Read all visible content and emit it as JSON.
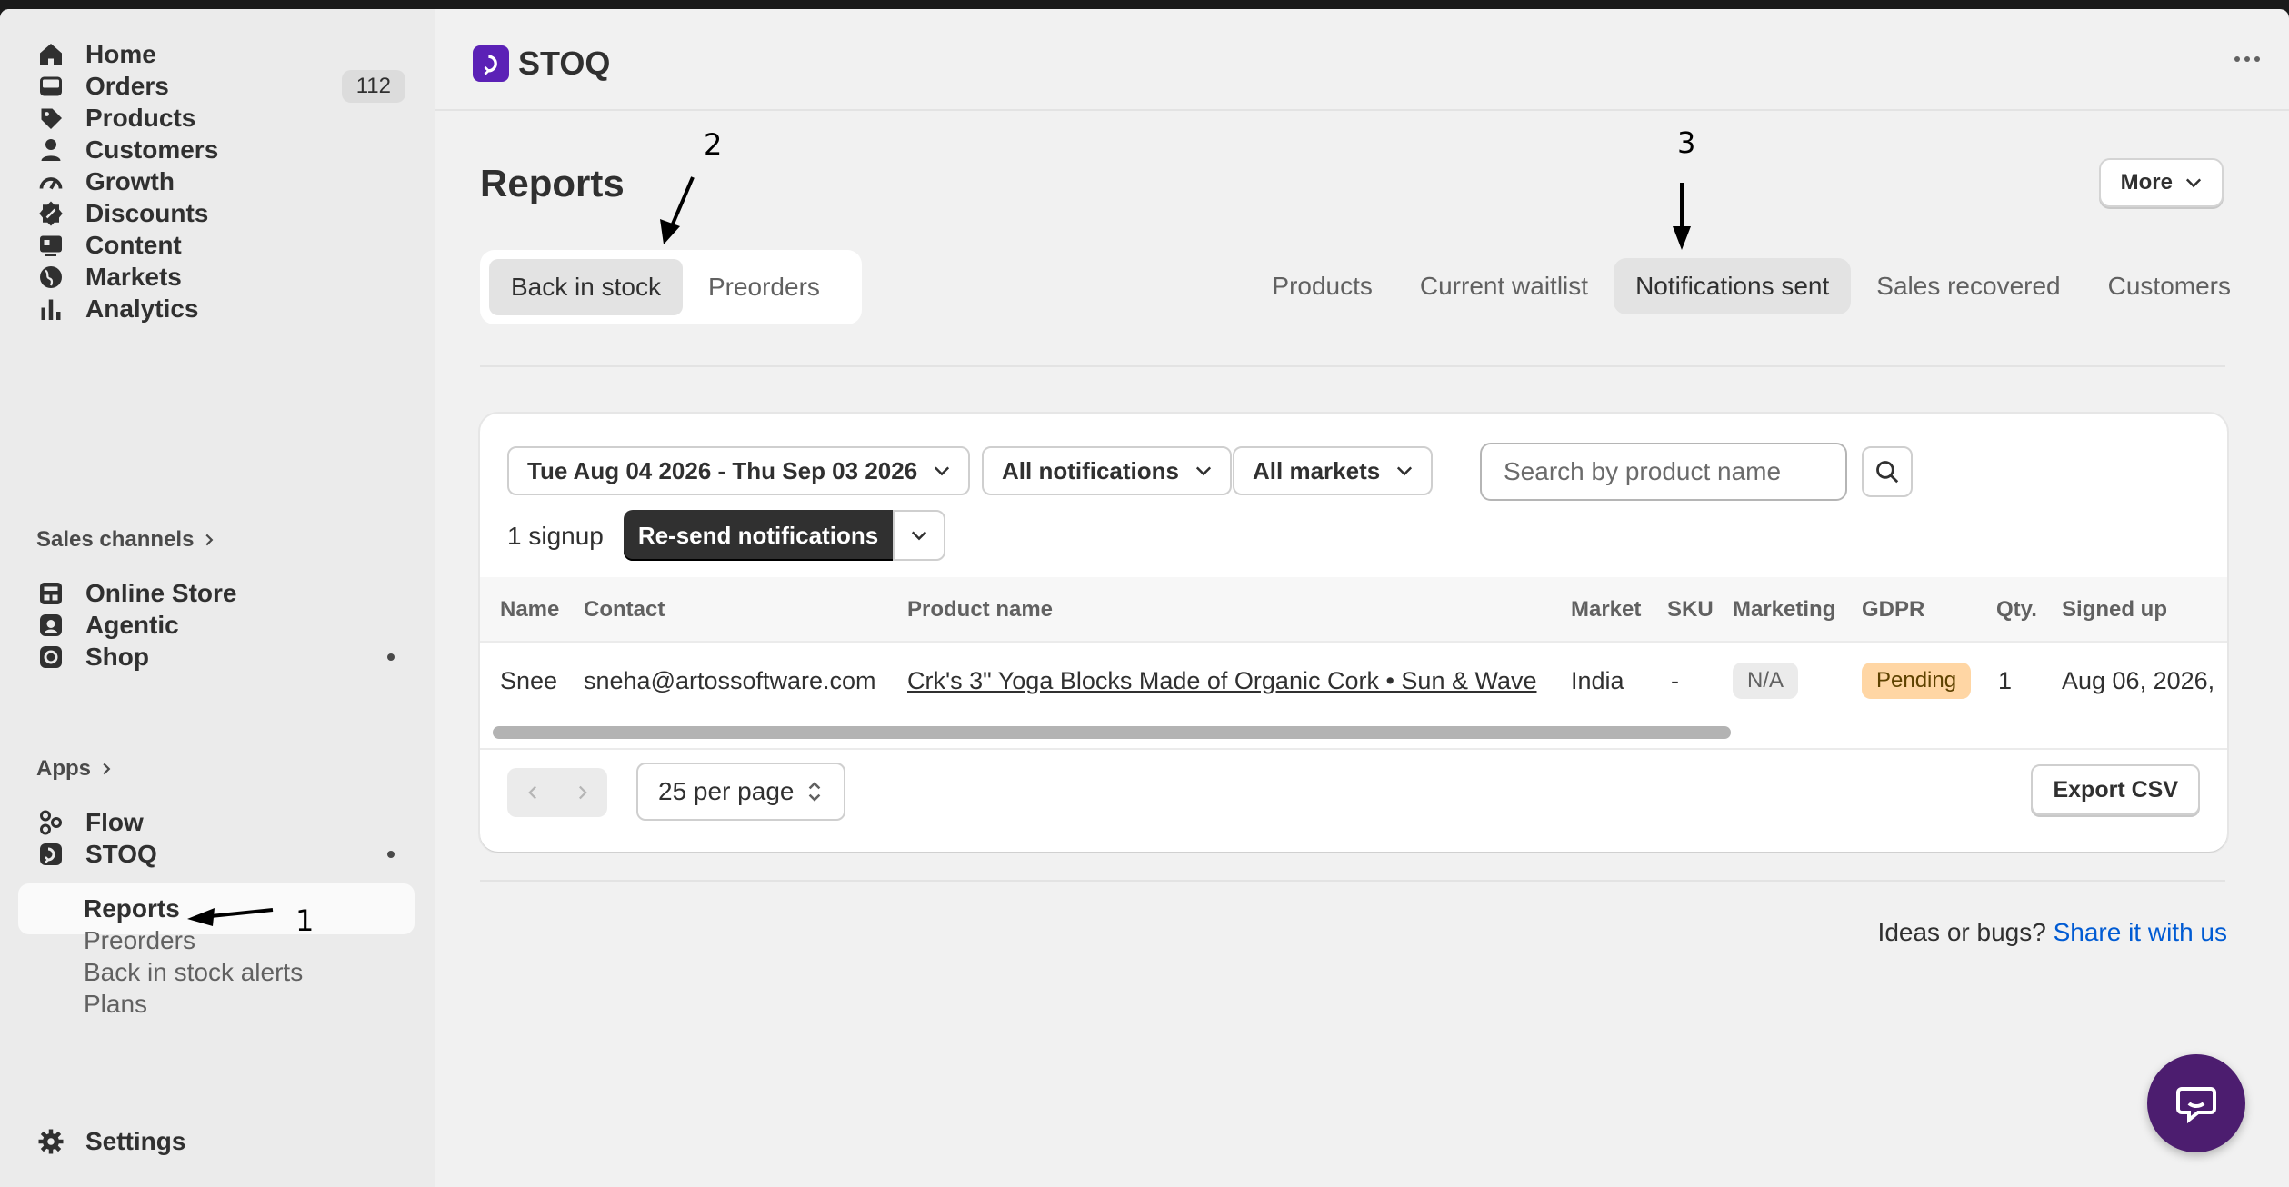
{
  "sidebar": {
    "main_items": [
      {
        "label": "Home",
        "icon": "home-icon"
      },
      {
        "label": "Orders",
        "icon": "inbox-icon",
        "badge": "112"
      },
      {
        "label": "Products",
        "icon": "tag-icon"
      },
      {
        "label": "Customers",
        "icon": "person-icon"
      },
      {
        "label": "Growth",
        "icon": "gauge-icon"
      },
      {
        "label": "Discounts",
        "icon": "discount-icon"
      },
      {
        "label": "Content",
        "icon": "content-icon"
      },
      {
        "label": "Markets",
        "icon": "globe-icon"
      },
      {
        "label": "Analytics",
        "icon": "bar-chart-icon"
      }
    ],
    "sales_channels_label": "Sales channels",
    "channels": [
      {
        "label": "Online Store",
        "icon": "store-icon"
      },
      {
        "label": "Agentic",
        "icon": "agentic-icon"
      },
      {
        "label": "Shop",
        "icon": "shop-icon"
      }
    ],
    "apps_label": "Apps",
    "apps": [
      {
        "label": "Flow",
        "icon": "flow-icon"
      },
      {
        "label": "STOQ",
        "icon": "stoq-icon"
      }
    ],
    "stoq_sub": [
      "Reports",
      "Preorders",
      "Back in stock alerts",
      "Plans"
    ],
    "settings_label": "Settings"
  },
  "header": {
    "app_name": "STOQ"
  },
  "page": {
    "title": "Reports",
    "more_label": "More",
    "segments": [
      "Back in stock",
      "Preorders"
    ],
    "tabs": [
      "Products",
      "Current waitlist",
      "Notifications sent",
      "Sales recovered",
      "Customers"
    ]
  },
  "filters": {
    "date_range": "Tue Aug 04 2026 - Thu Sep 03 2026",
    "notification_filter": "All notifications",
    "market_filter": "All markets",
    "search_placeholder": "Search by product name"
  },
  "bulk": {
    "count_label": "1 signup",
    "resend_label": "Re-send notifications"
  },
  "table": {
    "columns": [
      "Name",
      "Contact",
      "Product name",
      "Market",
      "SKU",
      "Marketing",
      "GDPR",
      "Qty.",
      "Signed up"
    ],
    "rows": [
      {
        "name": "Snee",
        "contact": "sneha@artossoftware.com",
        "product": "Crk's 3\" Yoga Blocks Made of Organic Cork • Sun & Wave",
        "market": "India",
        "sku": "-",
        "marketing": "N/A",
        "gdpr": "Pending",
        "qty": "1",
        "signed_up": "Aug 06, 2026,"
      }
    ]
  },
  "pagination": {
    "per_page": "25 per page",
    "export_label": "Export CSV"
  },
  "footer": {
    "prefix": "Ideas or bugs?",
    "link": "Share it with us"
  },
  "annotations": [
    "1",
    "2",
    "3"
  ],
  "colors": {
    "brand": "#5b21b6",
    "chat": "#4c1d6f",
    "link": "#005bd3",
    "pending": "#ffd6a4"
  }
}
